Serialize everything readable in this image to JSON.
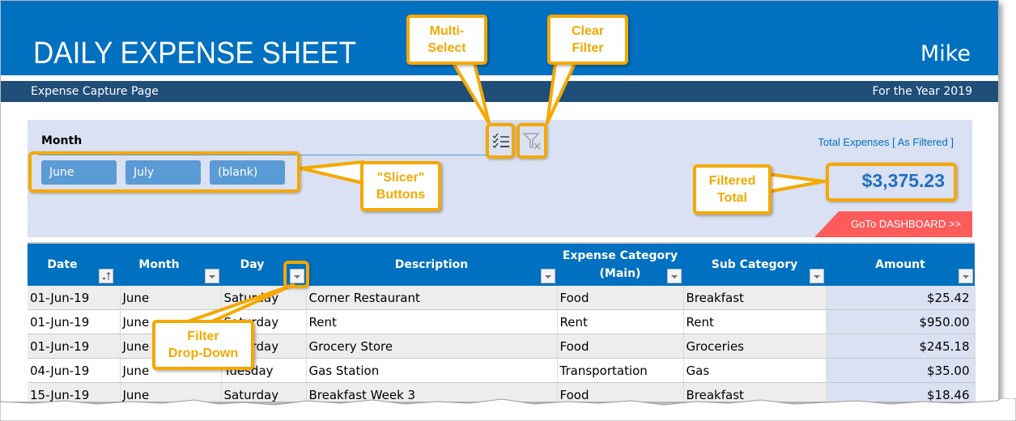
{
  "header": {
    "title": "DAILY EXPENSE SHEET",
    "user": "Mike",
    "subtitle": "Expense Capture Page",
    "year_label": "For the Year 2019"
  },
  "slicer": {
    "label": "Month",
    "buttons": [
      "June",
      "July",
      "(blank)"
    ],
    "multi_select_icon": "multi-select-checklist-icon",
    "clear_filter_icon": "clear-filter-funnel-icon"
  },
  "summary": {
    "total_label": "Total Expenses [ As Filtered ]",
    "total_value": "$3,375.23",
    "dashboard_button": "GoTo DASHBOARD >>"
  },
  "table": {
    "columns": [
      {
        "label": "Date",
        "filter": "sort-ascending"
      },
      {
        "label": "Month",
        "filter": "dropdown"
      },
      {
        "label": "Day",
        "filter": "dropdown"
      },
      {
        "label": "Description",
        "filter": "dropdown"
      },
      {
        "label": "Expense Category (Main)",
        "label_line1": "Expense Category",
        "label_line2": "(Main)",
        "filter": "dropdown"
      },
      {
        "label": "Sub Category",
        "filter": "dropdown"
      },
      {
        "label": "Amount",
        "filter": "dropdown"
      }
    ],
    "rows": [
      {
        "date": "01-Jun-19",
        "month": "June",
        "day": "Saturday",
        "description": "Corner Restaurant",
        "category": "Food",
        "sub": "Breakfast",
        "amount": "$25.42"
      },
      {
        "date": "01-Jun-19",
        "month": "June",
        "day": "Saturday",
        "description": "Rent",
        "category": "Rent",
        "sub": "Rent",
        "amount": "$950.00"
      },
      {
        "date": "01-Jun-19",
        "month": "June",
        "day": "Saturday",
        "description": "Grocery Store",
        "category": "Food",
        "sub": "Groceries",
        "amount": "$245.18"
      },
      {
        "date": "04-Jun-19",
        "month": "June",
        "day": "Tuesday",
        "description": "Gas Station",
        "category": "Transportation",
        "sub": "Gas",
        "amount": "$35.00"
      },
      {
        "date": "15-Jun-19",
        "month": "June",
        "day": "Saturday",
        "description": "Breakfast Week 3",
        "category": "Food",
        "sub": "Breakfast",
        "amount": "$18.46"
      }
    ]
  },
  "callouts": {
    "multi_select": "Multi-\nSelect",
    "clear_filter": "Clear\nFilter",
    "slicer_buttons": "\"Slicer\"\nButtons",
    "filtered_total": "Filtered\nTotal",
    "filter_dropdown": "Filter\nDrop-Down"
  },
  "colors": {
    "header_blue": "#0070c0",
    "subheader_navy": "#1f4e79",
    "panel_bg": "#d9e1f2",
    "slicer_button": "#5b9bd5",
    "dashboard_red": "#ff5b5b",
    "callout_orange": "#f5a800"
  }
}
